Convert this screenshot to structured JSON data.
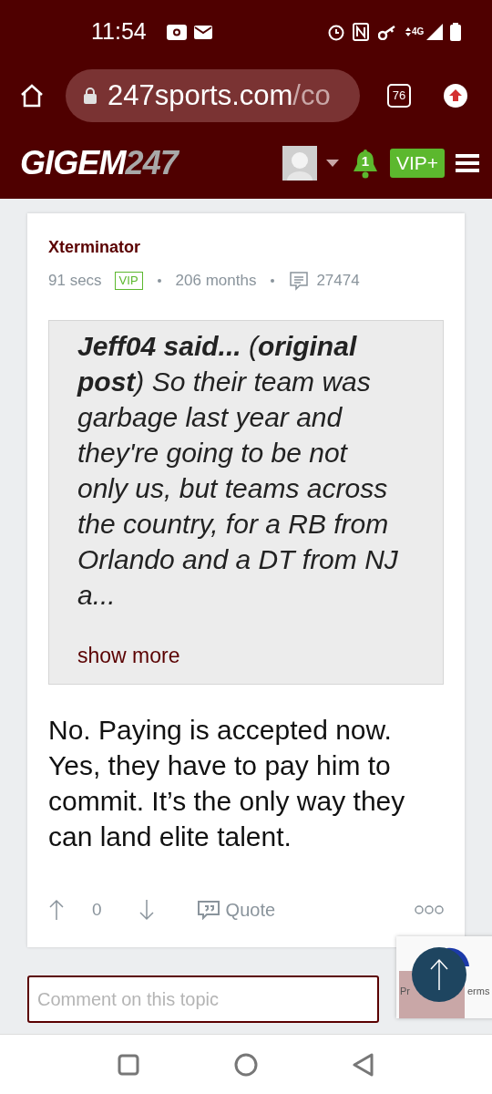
{
  "status_bar": {
    "time": "11:54",
    "network": "4G"
  },
  "browser": {
    "url_host": "247sports.com",
    "url_path": "/co",
    "tab_count": "76"
  },
  "site_header": {
    "logo_main": "GIGEM",
    "logo_number": "247",
    "notification_count": "1",
    "vip_label": "VIP+"
  },
  "post": {
    "author": "Xterminator",
    "time": "91 secs",
    "badge": "VIP",
    "tenure": "206 months",
    "post_count": "27474",
    "quote": {
      "text": "**Jeff04 said...** (**original post**) So their team was garbage last year and they're going to be not only us, but teams across the country, for a RB from Orlando and a DT from NJ a...",
      "show_more": "show more"
    },
    "body": "No. Paying is accepted now. Yes, they have to pay him to commit. It’s the only way they can land elite talent.",
    "votes": "0",
    "quote_label": "Quote"
  },
  "comment": {
    "placeholder": "Comment on this topic"
  },
  "recaptcha": {
    "left_text": "Pr",
    "right_text": "erms"
  }
}
